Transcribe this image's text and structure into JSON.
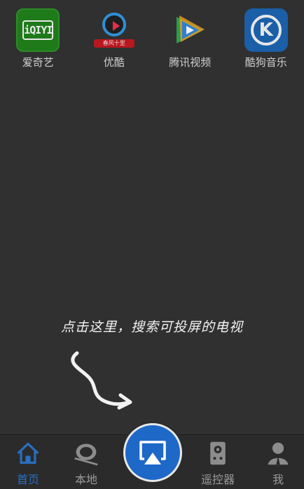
{
  "apps": [
    {
      "label": "爱奇艺",
      "icon": "iqiyi-icon",
      "logo_text": "iQIYI"
    },
    {
      "label": "优酷",
      "icon": "youku-icon",
      "banner_text": "春风十里"
    },
    {
      "label": "腾讯视频",
      "icon": "tencent-video-icon"
    },
    {
      "label": "酷狗音乐",
      "icon": "kugou-icon",
      "logo_text": "K"
    }
  ],
  "hint": {
    "text": "点击这里，搜索可投屏的电视"
  },
  "tabs": [
    {
      "label": "首页",
      "icon": "home-icon",
      "active": true
    },
    {
      "label": "本地",
      "icon": "film-reel-icon",
      "active": false
    },
    {
      "label": "遥控器",
      "icon": "remote-icon",
      "active": false
    },
    {
      "label": "我",
      "icon": "user-icon",
      "active": false
    }
  ],
  "cast_button": {
    "icon": "airplay-icon"
  },
  "colors": {
    "background": "#303030",
    "accent": "#2a6fc0",
    "cast_button": "#1e68c8"
  }
}
